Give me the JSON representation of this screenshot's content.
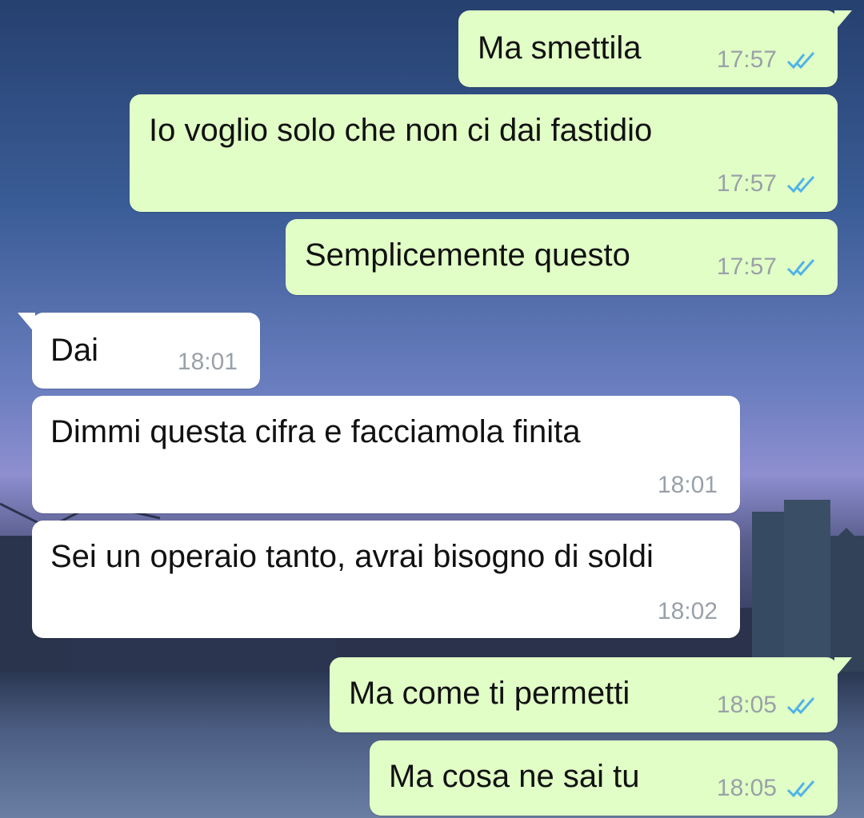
{
  "messages": [
    {
      "text": "Ma smettila",
      "time": "17:57"
    },
    {
      "text": "Io voglio solo che non ci dai fastidio",
      "time": "17:57"
    },
    {
      "text": "Semplicemente questo",
      "time": "17:57"
    },
    {
      "text": "Dai",
      "time": "18:01"
    },
    {
      "text": "Dimmi questa cifra e facciamola finita",
      "time": "18:01"
    },
    {
      "text": "Sei un operaio tanto, avrai bisogno di soldi",
      "time": "18:02"
    },
    {
      "text": "Ma come ti permetti",
      "time": "18:05"
    },
    {
      "text": "Ma cosa ne sai tu",
      "time": "18:05"
    }
  ],
  "colors": {
    "outgoing_bubble": "#e1fec6",
    "incoming_bubble": "#ffffff",
    "read_ticks": "#4fb3e8"
  },
  "icons": {
    "read_receipt": "double-check-icon"
  }
}
